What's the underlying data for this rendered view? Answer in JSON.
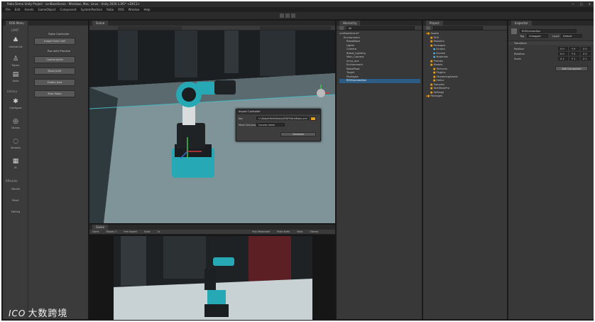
{
  "window": {
    "title": "Robo Demo Unity Project - scnBaseScene - Windows, Mac, Linux - Unity 2020.1.0f1* <DX11>",
    "controls": [
      "—",
      "□",
      "✕"
    ]
  },
  "menu": [
    "File",
    "Edit",
    "Assets",
    "GameObject",
    "Component",
    "SystemPosition",
    "Robo",
    "ROS",
    "Window",
    "Help"
  ],
  "left_dock": {
    "tab": "ROS Menu",
    "sections": [
      "LIMIT",
      "Library",
      "RReader"
    ],
    "items": [
      "Control Lib",
      "Topics",
      "Units",
      "Configure",
      "Drives",
      "Sensors",
      "IK",
      "MoveIt",
      "Move",
      "Editing"
    ],
    "button_header": "Robo Controller",
    "sub_header": "Ros with Preview",
    "buttons": [
      "Import from Urdf",
      "Control Joints",
      "Move JLinK",
      "Enable Joint",
      "Start Motor"
    ]
  },
  "scene": {
    "tab": "Scene",
    "dialog": {
      "title": "Import Controller",
      "fields": [
        {
          "label": "Key",
          "value": "C:\\Robot\\Path\\Robo\\URDF\\Path\\Robo.xml"
        },
        {
          "label": "Mesh Decomp Mode",
          "value": "Convex mesh"
        }
      ],
      "button": "Generate"
    }
  },
  "game": {
    "tab": "Game",
    "toolbar": [
      "Game",
      "Display 1",
      "Free Aspect",
      "Scale",
      "1x",
      "Play Maximized",
      "Mute Audio",
      "Stats",
      "Gizmos"
    ]
  },
  "hierarchy": {
    "tab": "Hierarchy",
    "search_placeholder": "All",
    "items": [
      "scnBaseScene*",
      "Environment",
      "RobotBase",
      "Lights",
      "Camera",
      "Robot_Lighting",
      "Main_Camera",
      "niryo_one",
      "Environment",
      "RobotRoot",
      "Target",
      "Packages",
      "ROSConnection"
    ],
    "selected_index": 12
  },
  "project": {
    "tab": "Project",
    "items": [
      "Assets",
      "ROS",
      "Robotics",
      "Packages",
      "Scripts",
      "Scenes",
      "Materials",
      "Prefabs",
      "Models",
      "Textures",
      "Plugins",
      "StreamingAssets",
      "Editor",
      "Samples",
      "TextMeshPro",
      "Settings",
      "Packages"
    ]
  },
  "inspector": {
    "tab": "Inspector",
    "object_name": "ROSConnection",
    "tag_label": "Tag",
    "tag_value": "Untagged",
    "layer_label": "Layer",
    "layer_value": "Default",
    "component": "Transform",
    "rows": [
      {
        "label": "Position",
        "x": "X 0",
        "y": "Y 0",
        "z": "Z 0"
      },
      {
        "label": "Rotation",
        "x": "X 0",
        "y": "Y 0",
        "z": "Z 0"
      },
      {
        "label": "Scale",
        "x": "X 1",
        "y": "Y 1",
        "z": "Z 1"
      }
    ],
    "add_component": "Add Component"
  },
  "watermark": {
    "logo": "ICO",
    "text": "大数跨境"
  },
  "colors": {
    "selection": "#2c5d87",
    "robot_teal": "#27a9b5",
    "accent_orange": "#e6a020"
  }
}
